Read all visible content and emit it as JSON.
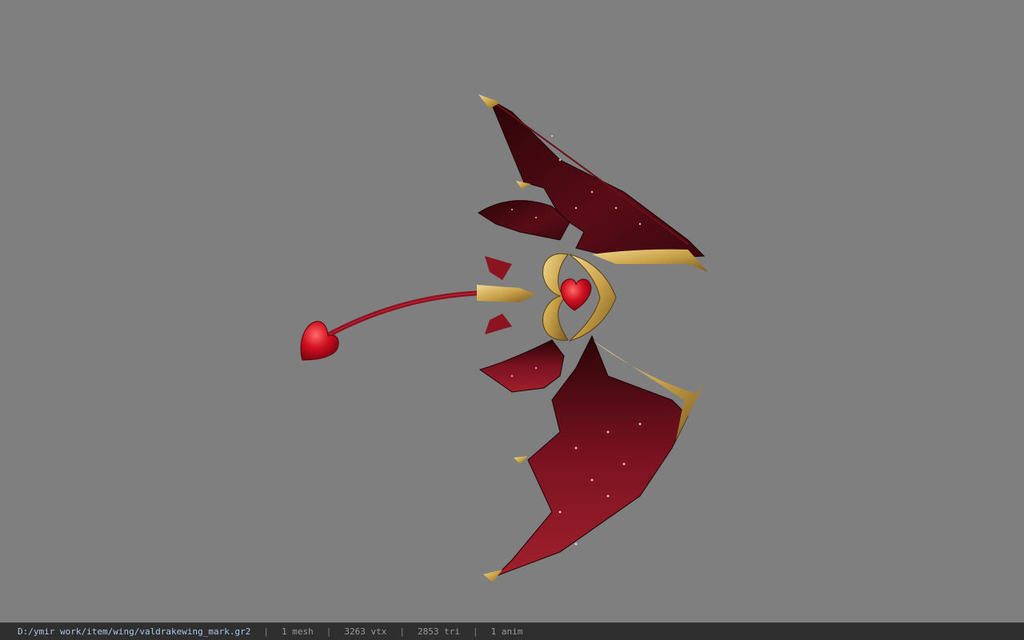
{
  "viewer": {
    "model_name": "valdrakewing_mark",
    "background_color": "#7f7f7f"
  },
  "status_bar": {
    "file_path": "D:/ymir work/item/wing/valdrakewing_mark.gr2",
    "separator": "|",
    "mesh_count": "1 mesh",
    "vertex_count": "3263 vtx",
    "triangle_count": "2853 tri",
    "anim_count": "1 anim"
  },
  "colors": {
    "wing_membrane_dark": "#3a0810",
    "wing_membrane_light": "#8a1420",
    "gold_frame": "#c9a24a",
    "heart_red": "#d01020"
  }
}
